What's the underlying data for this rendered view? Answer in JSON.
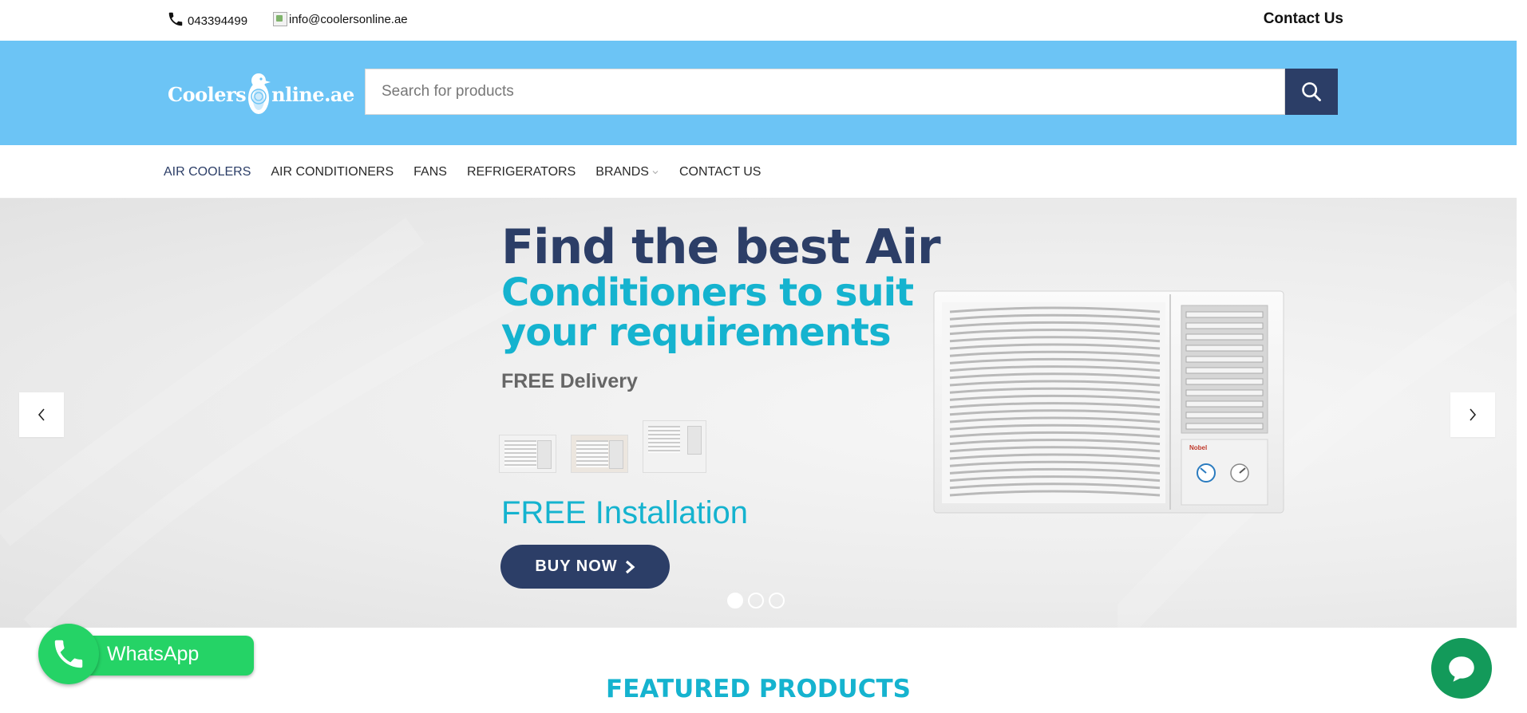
{
  "topbar": {
    "phone": "043394499",
    "email": "info@coolersonline.ae",
    "contact_link": "Contact Us"
  },
  "header": {
    "logo_text_left": "Coolers",
    "logo_text_right": "nline.ae",
    "search_placeholder": "Search for products"
  },
  "nav": {
    "items": [
      {
        "label": "AIR COOLERS"
      },
      {
        "label": "AIR CONDITIONERS"
      },
      {
        "label": "FANS"
      },
      {
        "label": "REFRIGERATORS"
      },
      {
        "label": "BRANDS"
      },
      {
        "label": "CONTACT US"
      }
    ]
  },
  "hero": {
    "title_line1": "Find the best Air",
    "title_line2": "Conditioners to suit your requirements",
    "free_delivery": "FREE Delivery",
    "free_installation": "FREE Installation",
    "buy_button": "BUY NOW",
    "slide_count": 3,
    "active_slide": 1,
    "ac_brand": "Nobel"
  },
  "featured": {
    "title": "FEATURED PRODUCTS"
  },
  "whatsapp": {
    "label": "WhatsApp"
  },
  "colors": {
    "header_bg": "#6cc4f5",
    "navy": "#2c3e67",
    "cyan": "#15b3cf",
    "whatsapp_green": "#25d366",
    "chat_green": "#139a5a"
  }
}
